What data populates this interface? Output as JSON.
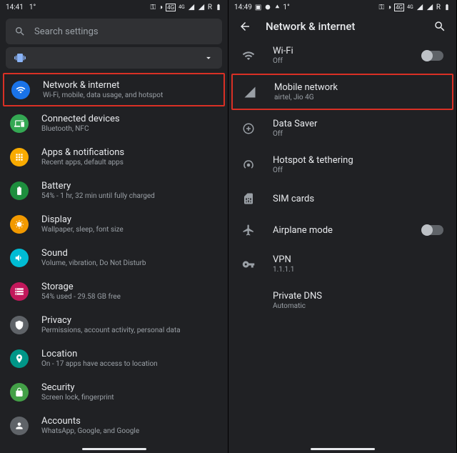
{
  "left": {
    "status": {
      "time": "14:41",
      "right_text": "R"
    },
    "search_placeholder": "Search settings",
    "items": [
      {
        "title": "Network & internet",
        "sub": "Wi-Fi, mobile, data usage, and hotspot",
        "color": "#1a73e8",
        "highlight": true
      },
      {
        "title": "Connected devices",
        "sub": "Bluetooth, NFC",
        "color": "#34a853"
      },
      {
        "title": "Apps & notifications",
        "sub": "Recent apps, default apps",
        "color": "#f9ab00"
      },
      {
        "title": "Battery",
        "sub": "54% - 1 hr, 32 min until fully charged",
        "color": "#1e8e3e"
      },
      {
        "title": "Display",
        "sub": "Wallpaper, sleep, font size",
        "color": "#f29900"
      },
      {
        "title": "Sound",
        "sub": "Volume, vibration, Do Not Disturb",
        "color": "#00bcd4"
      },
      {
        "title": "Storage",
        "sub": "54% used - 29.58 GB free",
        "color": "#c2185b"
      },
      {
        "title": "Privacy",
        "sub": "Permissions, account activity, personal data",
        "color": "#5f6368"
      },
      {
        "title": "Location",
        "sub": "On - 17 apps have access to location",
        "color": "#009688"
      },
      {
        "title": "Security",
        "sub": "Screen lock, fingerprint",
        "color": "#43a047"
      },
      {
        "title": "Accounts",
        "sub": "WhatsApp, Google, and Google",
        "color": "#5f6368"
      }
    ]
  },
  "right": {
    "status": {
      "time": "14:49",
      "right_text": "R"
    },
    "header_title": "Network & internet",
    "items": [
      {
        "title": "Wi-Fi",
        "sub": "Off",
        "toggle": true
      },
      {
        "title": "Mobile network",
        "sub": "airtel, Jio 4G",
        "highlight": true
      },
      {
        "title": "Data Saver",
        "sub": "Off"
      },
      {
        "title": "Hotspot & tethering",
        "sub": "Off"
      },
      {
        "title": "SIM cards",
        "sub": ""
      },
      {
        "title": "Airplane mode",
        "sub": "",
        "toggle": true
      },
      {
        "title": "VPN",
        "sub": "1.1.1.1"
      },
      {
        "title": "Private DNS",
        "sub": "Automatic"
      }
    ]
  }
}
